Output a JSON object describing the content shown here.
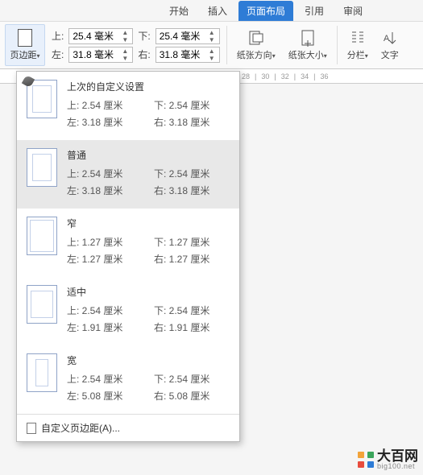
{
  "tabs": {
    "start": "开始",
    "insert": "插入",
    "layout": "页面布局",
    "reference": "引用",
    "review": "审阅"
  },
  "marginBtn": {
    "label": "页边距"
  },
  "spin": {
    "topLabel": "上:",
    "topVal": "25.4 毫米",
    "bottomLabel": "下:",
    "bottomVal": "25.4 毫米",
    "leftLabel": "左:",
    "leftVal": "31.8 毫米",
    "rightLabel": "右:",
    "rightVal": "31.8 毫米"
  },
  "ribbon": {
    "orientation": "纸张方向",
    "size": "纸张大小",
    "columns": "分栏",
    "textdir": "文字"
  },
  "ruler": [
    "28",
    "30",
    "32",
    "34",
    "36"
  ],
  "presets": {
    "last": {
      "name": "上次的自定义设置",
      "top": "上: 2.54 厘米",
      "bottom": "下: 2.54 厘米",
      "left": "左: 3.18 厘米",
      "right": "右: 3.18 厘米"
    },
    "normal": {
      "name": "普通",
      "top": "上: 2.54 厘米",
      "bottom": "下: 2.54 厘米",
      "left": "左: 3.18 厘米",
      "right": "右: 3.18 厘米"
    },
    "narrow": {
      "name": "窄",
      "top": "上: 1.27 厘米",
      "bottom": "下: 1.27 厘米",
      "left": "左: 1.27 厘米",
      "right": "右: 1.27 厘米"
    },
    "moderate": {
      "name": "适中",
      "top": "上: 2.54 厘米",
      "bottom": "下: 2.54 厘米",
      "left": "左: 1.91 厘米",
      "right": "右: 1.91 厘米"
    },
    "wide": {
      "name": "宽",
      "top": "上: 2.54 厘米",
      "bottom": "下: 2.54 厘米",
      "left": "左: 5.08 厘米",
      "right": "右: 5.08 厘米"
    }
  },
  "custom": "自定义页边距(A)...",
  "watermark": {
    "text": "大百网",
    "url": "big100.net"
  }
}
